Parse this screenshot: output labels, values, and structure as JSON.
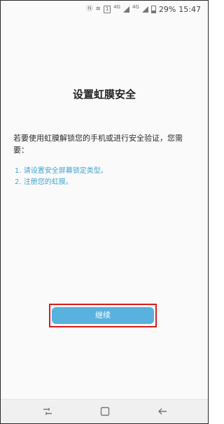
{
  "status_bar": {
    "sim_label": "1",
    "network_label": "4G",
    "network2_label": "4G",
    "battery_percent": "29%",
    "time": "15:47"
  },
  "main": {
    "title": "设置虹膜安全",
    "intro": "若要使用虹膜解锁您的手机或进行安全验证，您需要：",
    "steps": [
      "1. 请设置安全屏幕锁定类型。",
      "2. 注册您的虹膜。"
    ],
    "continue_label": "继续"
  },
  "colors": {
    "accent": "#3fa7d2",
    "button": "#58b2dd",
    "highlight": "#d61c1c"
  },
  "icons": {
    "nav_recent": "recent-apps-icon",
    "nav_home": "home-icon",
    "nav_back": "back-icon"
  }
}
